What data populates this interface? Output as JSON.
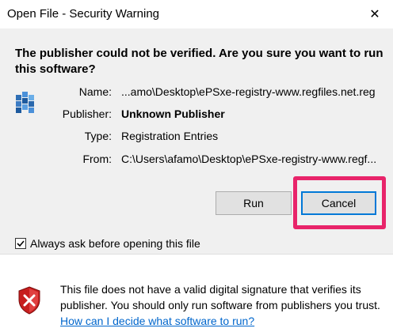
{
  "window": {
    "title": "Open File - Security Warning",
    "close_glyph": "✕"
  },
  "headline": "The publisher could not be verified.  Are you sure you want to run this software?",
  "fields": {
    "name_label": "Name:",
    "name_value": "...amo\\Desktop\\ePSxe-registry-www.regfiles.net.reg",
    "publisher_label": "Publisher:",
    "publisher_value": "Unknown Publisher",
    "type_label": "Type:",
    "type_value": "Registration Entries",
    "from_label": "From:",
    "from_value": "C:\\Users\\afamo\\Desktop\\ePSxe-registry-www.regf..."
  },
  "buttons": {
    "run_label": "Run",
    "cancel_label": "Cancel"
  },
  "checkbox": {
    "label": "Always ask before opening this file",
    "checked": true
  },
  "footer": {
    "text": "This file does not have a valid digital signature that verifies its publisher.  You should only run software from publishers you trust.",
    "link_text": "How can I decide what software to run?"
  },
  "colors": {
    "highlight": "#e8246a",
    "focus": "#0078d7",
    "link": "#0066cc"
  },
  "icons": {
    "file": "registry-file-icon",
    "shield": "security-shield-icon",
    "check": "checkmark-icon",
    "close": "close-icon"
  }
}
